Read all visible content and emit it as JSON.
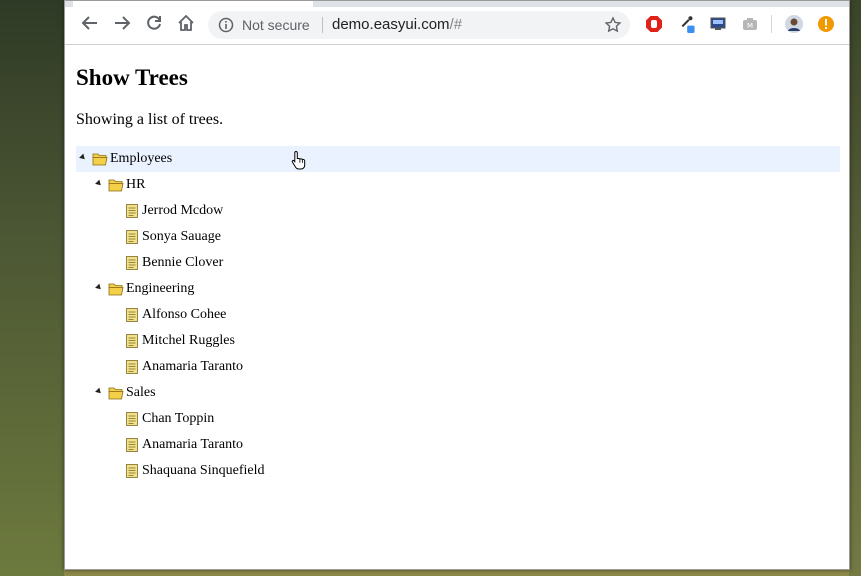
{
  "browser": {
    "security_label": "Not secure",
    "url_host": "demo.easyui.com",
    "url_path": "/#"
  },
  "page": {
    "title": "Show Trees",
    "description": "Showing a list of trees."
  },
  "tree": {
    "root": {
      "label": "Employees",
      "selected": true,
      "children": [
        {
          "label": "HR",
          "children": [
            "Jerrod Mcdow",
            "Sonya Sauage",
            "Bennie Clover"
          ]
        },
        {
          "label": "Engineering",
          "children": [
            "Alfonso Cohee",
            "Mitchel Ruggles",
            "Anamaria Taranto"
          ]
        },
        {
          "label": "Sales",
          "children": [
            "Chan Toppin",
            "Anamaria Taranto",
            "Shaquana Sinquefield"
          ]
        }
      ]
    }
  },
  "icons": {
    "folder_color": "#f4d04a",
    "file_color": "#f2e08a",
    "selection_bg": "#eaf2ff"
  }
}
